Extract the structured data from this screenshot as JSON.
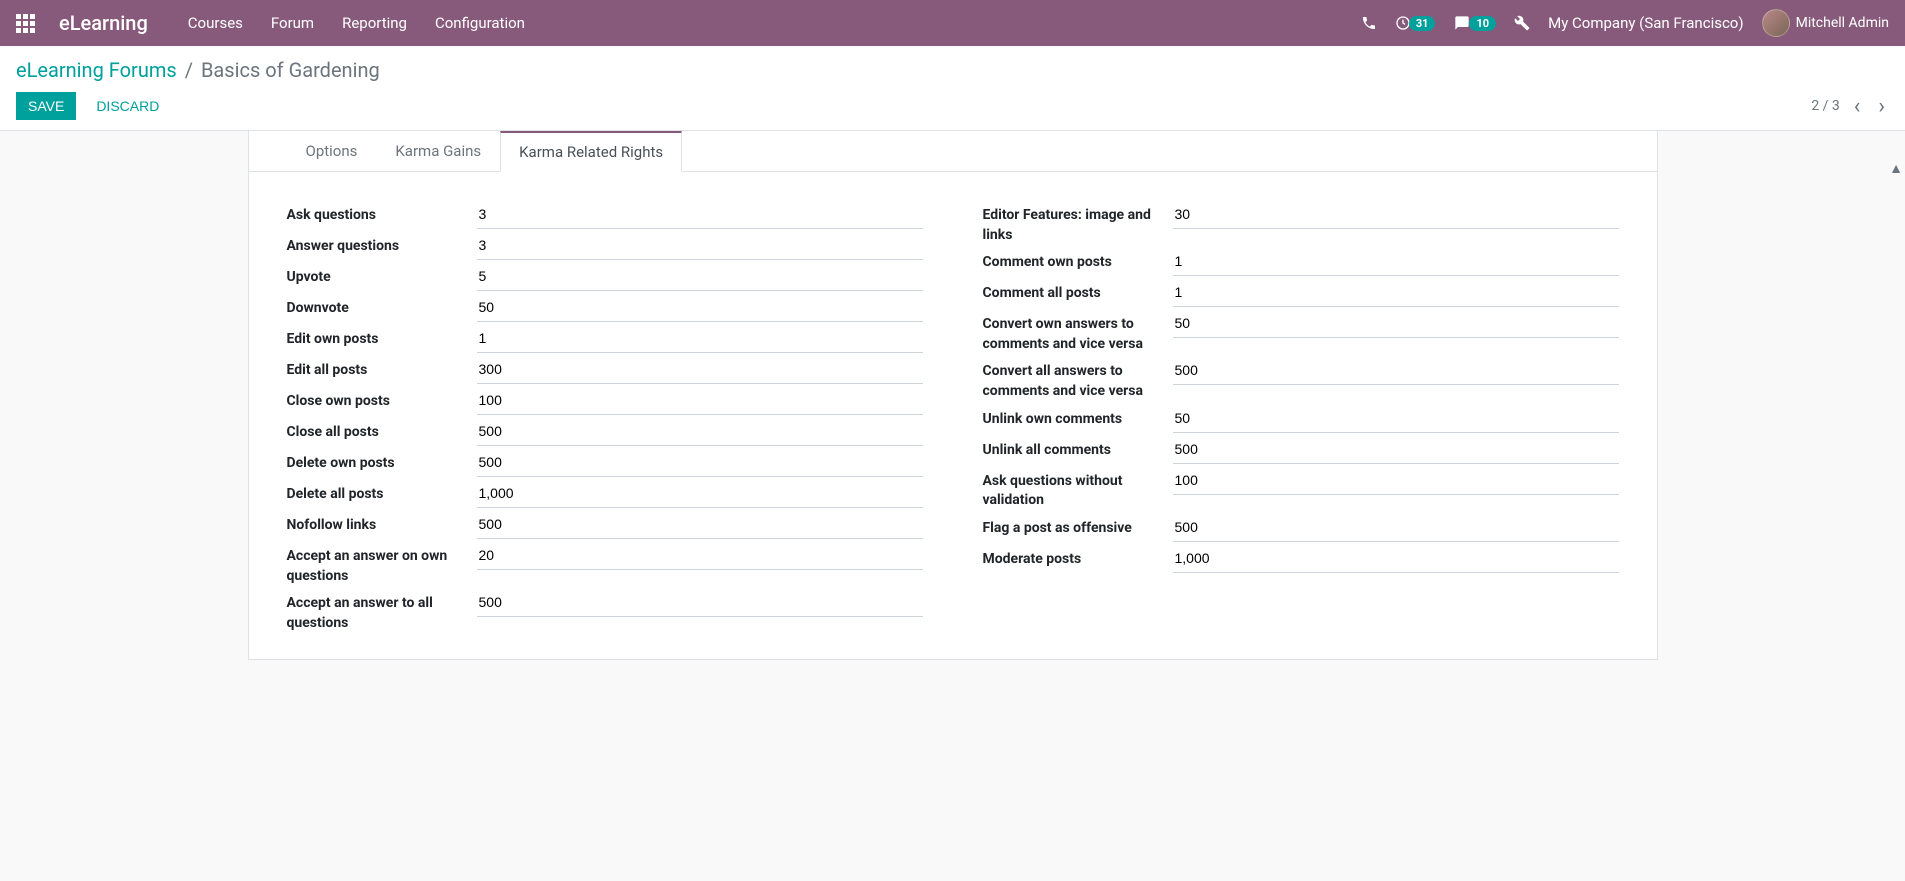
{
  "topbar": {
    "brand": "eLearning",
    "menu": [
      "Courses",
      "Forum",
      "Reporting",
      "Configuration"
    ],
    "activity_count": "31",
    "message_count": "10",
    "company": "My Company (San Francisco)",
    "user": "Mitchell Admin"
  },
  "breadcrumb": {
    "parent": "eLearning Forums",
    "separator": "/",
    "current": "Basics of Gardening"
  },
  "buttons": {
    "save": "Save",
    "discard": "Discard"
  },
  "pager": {
    "text": "2 / 3"
  },
  "tabs": {
    "options": "Options",
    "karma_gains": "Karma Gains",
    "karma_rights": "Karma Related Rights"
  },
  "left_fields": [
    {
      "label": "Ask questions",
      "value": "3"
    },
    {
      "label": "Answer questions",
      "value": "3"
    },
    {
      "label": "Upvote",
      "value": "5"
    },
    {
      "label": "Downvote",
      "value": "50"
    },
    {
      "label": "Edit own posts",
      "value": "1"
    },
    {
      "label": "Edit all posts",
      "value": "300"
    },
    {
      "label": "Close own posts",
      "value": "100"
    },
    {
      "label": "Close all posts",
      "value": "500"
    },
    {
      "label": "Delete own posts",
      "value": "500"
    },
    {
      "label": "Delete all posts",
      "value": "1,000"
    },
    {
      "label": "Nofollow links",
      "value": "500"
    },
    {
      "label": "Accept an answer on own questions",
      "value": "20"
    },
    {
      "label": "Accept an answer to all questions",
      "value": "500"
    }
  ],
  "right_fields": [
    {
      "label": "Editor Features: image and links",
      "value": "30"
    },
    {
      "label": "Comment own posts",
      "value": "1"
    },
    {
      "label": "Comment all posts",
      "value": "1"
    },
    {
      "label": "Convert own answers to comments and vice versa",
      "value": "50"
    },
    {
      "label": "Convert all answers to comments and vice versa",
      "value": "500"
    },
    {
      "label": "Unlink own comments",
      "value": "50"
    },
    {
      "label": "Unlink all comments",
      "value": "500"
    },
    {
      "label": "Ask questions without validation",
      "value": "100"
    },
    {
      "label": "Flag a post as offensive",
      "value": "500"
    },
    {
      "label": "Moderate posts",
      "value": "1,000"
    }
  ]
}
